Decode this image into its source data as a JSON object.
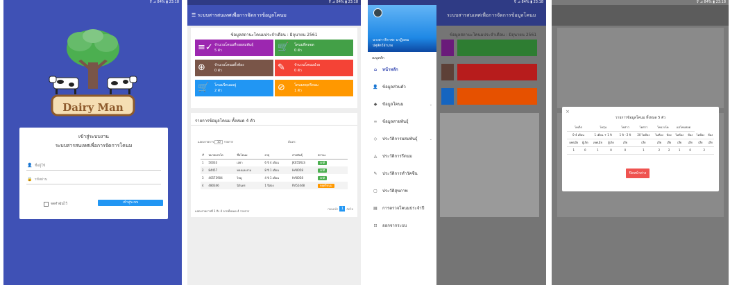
{
  "status_bar": {
    "text": "⊽ ⊿ 84% ▮ 23:18"
  },
  "login": {
    "app_name": "Dairy Man",
    "title": "เข้าสู่ระบบงาน",
    "subtitle": "ระบบสารสนเทศเพื่อการจัดการโคนม",
    "username_placeholder": "ชื่อผู้ใช้",
    "password_placeholder": "รหัสผ่าน",
    "remember_label": "จดจำฉันไว้",
    "login_button": "เข้าสู่ระบบ"
  },
  "dashboard": {
    "app_title": "ระบบสารสนเทศเพื่อการจัดการข้อมูลโคนม",
    "summary_title": "ข้อมูลสถานะโคนมประจำเดือน : มิถุนายน 2561",
    "tiles": [
      {
        "label": "จำนวนโคนมที่รอผสมพันธุ์",
        "value": "5 ตัว",
        "color": "#9c27b0",
        "icon": "playlist-check-icon",
        "glyph": "≡✓"
      },
      {
        "label": "โคนมที่คลอด",
        "value": "0 ตัว",
        "color": "#43a047",
        "icon": "cart-icon",
        "glyph": "🛒"
      },
      {
        "label": "จำนวนโคนมตั้งท้อง",
        "value": "0 ตัว",
        "color": "#795548",
        "icon": "plus-circle-icon",
        "glyph": "⊕"
      },
      {
        "label": "จำนวนโคนมป่วย",
        "value": "0 ตัว",
        "color": "#f44336",
        "icon": "syringe-icon",
        "glyph": "✎"
      },
      {
        "label": "โคนมรีดนมอยู่",
        "value": "2 ตัว",
        "color": "#2196f3",
        "icon": "cart-plus-icon",
        "glyph": "🛒"
      },
      {
        "label": "โคนมหยุดรีดนม",
        "value": "1 ตัว",
        "color": "#ff9800",
        "icon": "block-icon",
        "glyph": "⊘"
      }
    ],
    "list_title": "รายการข้อมูลโคนม ทั้งหมด 4 ตัว",
    "show_label": "แสดงรายการ",
    "show_value": "10",
    "show_suffix": "รายการ",
    "search_label": "ค้นหา:",
    "columns": [
      "#",
      "หมายเลขโค",
      "ชื่อโคนม",
      "อายุ",
      "สายพันธุ์",
      "สถานะ"
    ],
    "rows": [
      {
        "no": "1",
        "id": "50033",
        "name": "เสย่า",
        "age": "6 ปี 4 เดือน",
        "breed": "JK055RLS",
        "status": "ปกติ"
      },
      {
        "no": "2",
        "id": "84457",
        "name": "หลงแลงงาม",
        "age": "8 ปี 1 เดือน",
        "breed": "HA0058",
        "status": "ปกติ"
      },
      {
        "no": "3",
        "id": "40573904",
        "name": "ไหมู่",
        "age": "4 ปี 1 เดือน",
        "breed": "HA0058",
        "status": "ปกติ"
      },
      {
        "no": "4",
        "id": "480346",
        "name": "นิรันดร",
        "age": "1 ปีสอง",
        "breed": "RV52448",
        "status": "หยุดรีดนม"
      }
    ],
    "footer_text": "แสดงรายการที่ 1 ถึง 4 จากทั้งหมด 4 รายการ",
    "prev_label": "ก่อนหน้า",
    "page_number": "1",
    "next_label": "ถัดไป"
  },
  "drawer": {
    "user_name": "นางสาวจิราพร นาฏิอดม",
    "user_role": "ปศุสัตว์อำเภอ",
    "section_label": "เมนูหลัก",
    "items": [
      {
        "label": "หน้าหลัก",
        "icon": "home-icon",
        "glyph": "⌂",
        "caret": ""
      },
      {
        "label": "ข้อมูลส่วนตัว",
        "icon": "person-icon",
        "glyph": "👤",
        "caret": ""
      },
      {
        "label": "ข้อมูลโคนม",
        "icon": "tag-icon",
        "glyph": "◆",
        "caret": "⌄"
      },
      {
        "label": "ข้อมูลสายพันธุ์",
        "icon": "dna-icon",
        "glyph": "∞",
        "caret": ""
      },
      {
        "label": "ประวัติการผสมพันธุ์",
        "icon": "diamond-icon",
        "glyph": "◇",
        "caret": "⌄"
      },
      {
        "label": "ประวัติการรีดนม",
        "icon": "drop-icon",
        "glyph": "◬",
        "caret": ""
      },
      {
        "label": "ประวัติการทำวัคซีน",
        "icon": "needle-icon",
        "glyph": "✎",
        "caret": ""
      },
      {
        "label": "ประวัติสุขภาพ",
        "icon": "clipboard-icon",
        "glyph": "▢",
        "caret": ""
      },
      {
        "label": "การตรวจโคนมประจำปี",
        "icon": "report-icon",
        "glyph": "▤",
        "caret": ""
      },
      {
        "label": "ออกจากระบบ",
        "icon": "logout-icon",
        "glyph": "⊡",
        "caret": ""
      }
    ]
  },
  "modal": {
    "title": "รายการข้อมูลโคนม ทั้งหมด 5 ตัว",
    "group_headers": [
      "โคเล็ก",
      "โครุ่น",
      "โคสาว",
      "โคสาว",
      "โคนางโค",
      "แม่โคนทอด"
    ],
    "age_row": [
      "0-4 เดือน",
      "1 เดือน + 1 ปี",
      "1 ปี - 2 ปี",
      "20 ไม่ท้อง",
      "ไม่ท้อง",
      "ท้อง",
      "ไม่ท้อง",
      "ท้อง",
      "ไม่ท้อง",
      "ท้อง"
    ],
    "sex_row": [
      "เพศเมีย",
      "ผู้เกิด",
      "เพศเมีย",
      "ผู้เกิด",
      "เสีย",
      "เสีย",
      "เสีย",
      "เสีย",
      "เสีย",
      "เสีย",
      "เสีย",
      "เสีย"
    ],
    "values": [
      "1",
      "0",
      "1",
      "0",
      "0",
      "1",
      "2",
      "2",
      "1",
      "0",
      "2"
    ],
    "close_button": "ปิดหน้าต่าง"
  }
}
